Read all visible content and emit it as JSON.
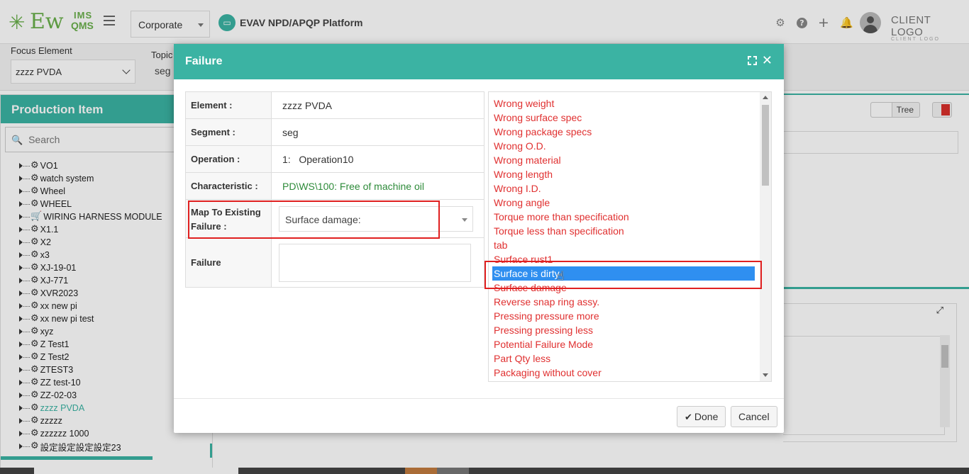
{
  "header": {
    "logo_main": "Ew",
    "logo_ims": "IMS",
    "logo_qms": "QMS",
    "org_select": "Corporate",
    "platform_title": "EVAV NPD/APQP Platform",
    "client_logo": "CLIENT LOGO",
    "client_logo_small": "CLIENT LOGO",
    "icons": [
      "gear-icon",
      "help-icon",
      "plus-icon",
      "bell-icon",
      "avatar"
    ]
  },
  "filters": {
    "focus_label": "Focus Element",
    "focus_value": "zzzz PVDA",
    "topic_label": "Topic",
    "topic_value": "seg"
  },
  "left_panel": {
    "title": "Production Item",
    "search_placeholder": "Search",
    "items": [
      "VO1",
      "watch system",
      "Wheel",
      "WHEEL",
      "WIRING HARNESS MODULE",
      "X1.1",
      "X2",
      "x3",
      "XJ-19-01",
      "XJ-771",
      "XVR2023",
      "xx new pi",
      "xx new pi test",
      "xyz",
      "Z Test1",
      "Z Test2",
      "ZTEST3",
      "ZZ test-10",
      "ZZ-02-03",
      "zzzz PVDA",
      "zzzzz",
      "zzzzzz 1000",
      "設定設定設定設定23"
    ],
    "active_item": "zzzz PVDA"
  },
  "right_panel": {
    "tree_toggle_label": "Tree"
  },
  "modal": {
    "title": "Failure",
    "fields": {
      "element_label": "Element :",
      "element_value": "zzzz PVDA",
      "segment_label": "Segment :",
      "segment_value": "seg",
      "operation_label": "Operation :",
      "operation_value": "1:   Operation10",
      "characteristic_label": "Characteristic :",
      "characteristic_value": "PD\\WS\\100: Free of machine oil",
      "map_label": "Map To Existing Failure :",
      "map_value": "Surface damage:",
      "failure_label": "Failure",
      "failure_value": ""
    },
    "options": [
      "Wrong weight",
      "Wrong surface spec",
      "Wrong package specs",
      "Wrong O.D.",
      "Wrong material",
      "Wrong length",
      "Wrong I.D.",
      "Wrong angle",
      "Torque more than specification",
      "Torque less than specification",
      "tab",
      "Surface rust1",
      "Surface is dirty",
      "Surface damage",
      "Reverse snap ring assy.",
      "Pressing pressure more",
      "Pressing pressing less",
      "Potential Failure Mode",
      "Part Qty less",
      "Packaging without cover"
    ],
    "selected_option": "Surface is dirty",
    "done_label": "Done",
    "cancel_label": "Cancel"
  },
  "colors": {
    "accent": "#3bb3a3",
    "option_text": "#e03030",
    "selection": "#2f8ff0",
    "highlight_box": "#e02020",
    "characteristic_text": "#2e8b3a"
  }
}
